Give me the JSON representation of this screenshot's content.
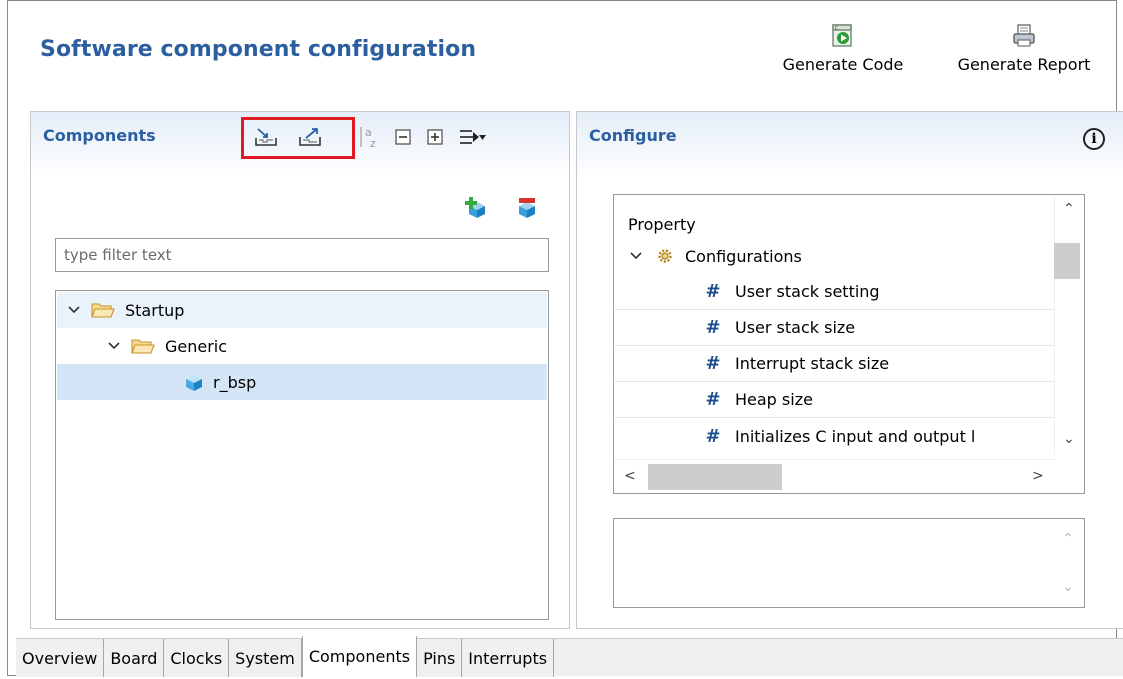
{
  "header": {
    "title": "Software component configuration",
    "generate_code_label": "Generate Code",
    "generate_report_label": "Generate Report"
  },
  "components_panel": {
    "title": "Components",
    "filter_placeholder": "type filter text",
    "tree": [
      {
        "label": "Startup",
        "expanded": true
      },
      {
        "label": "Generic",
        "expanded": true
      },
      {
        "label": "r_bsp",
        "selected": true
      }
    ]
  },
  "configure_panel": {
    "title": "Configure",
    "property_header": "Property",
    "group_label": "Configurations",
    "properties": [
      "User stack setting",
      "User stack size",
      "Interrupt stack size",
      "Heap size",
      "Initializes C input and output l"
    ],
    "property_icon_glyph": "#"
  },
  "bottom_tabs": [
    {
      "label": "Overview",
      "active": false
    },
    {
      "label": "Board",
      "active": false
    },
    {
      "label": "Clocks",
      "active": false
    },
    {
      "label": "System",
      "active": false
    },
    {
      "label": "Components",
      "active": true
    },
    {
      "label": "Pins",
      "active": false
    },
    {
      "label": "Interrupts",
      "active": false
    }
  ],
  "colors": {
    "title_blue": "#2b5fa0",
    "highlight_red": "#e01a22",
    "selection": "#d3e5f6"
  }
}
